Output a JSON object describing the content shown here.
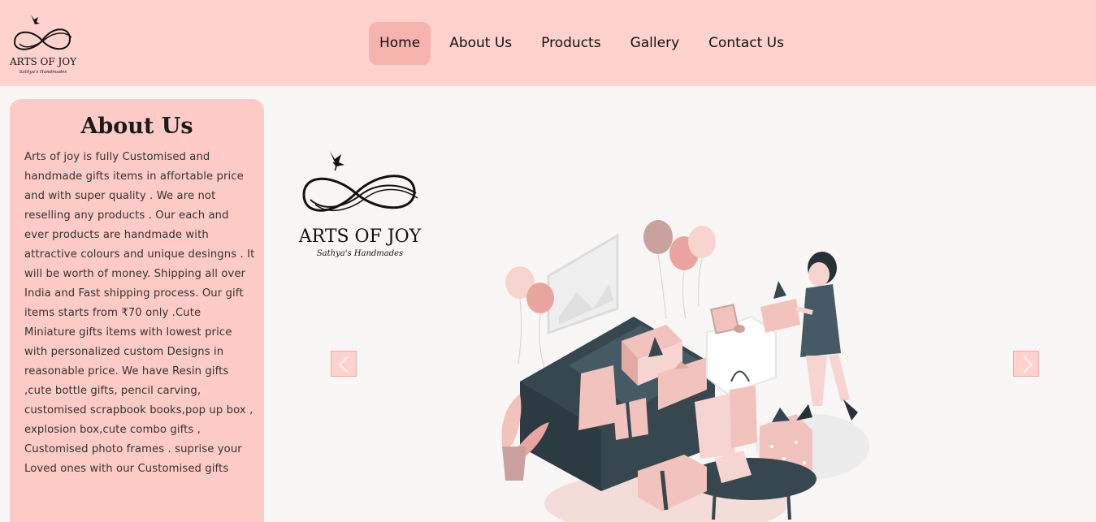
{
  "brand": {
    "name": "ARTS OF JOY",
    "tagline": "Sathya's Handmades"
  },
  "nav": {
    "items": [
      {
        "label": "Home",
        "active": true
      },
      {
        "label": "About Us",
        "active": false
      },
      {
        "label": "Products",
        "active": false
      },
      {
        "label": "Gallery",
        "active": false
      },
      {
        "label": "Contact Us",
        "active": false
      }
    ]
  },
  "about": {
    "title": "About Us",
    "text": "Arts of joy is fully Customised and handmade gifts items in affortable price and with super quality . We are not reselling any products . Our each and ever products are handmade with attractive colours and unique desingns . It will be worth of money. Shipping all over India and Fast shipping process. Our gift items starts from ₹70 only .Cute Miniature gifts items with lowest price with personalized custom Designs in reasonable price. We have Resin gifts ,cute bottle gifts, pencil carving, customised scrapbook books,pop up box , explosion box,cute combo gifts , Customised photo frames . suprise your Loved ones with our Customised gifts"
  },
  "carousel": {
    "prev_icon": "chevron-left-icon",
    "next_icon": "chevron-right-icon"
  },
  "colors": {
    "header_bg": "#ffd2ce",
    "active_nav_bg": "#f7b4ae",
    "panel_bg": "#ffcbc6",
    "page_bg": "#f9f7f5",
    "illustration_dark": "#37474f",
    "illustration_pink": "#f2c2bd"
  }
}
